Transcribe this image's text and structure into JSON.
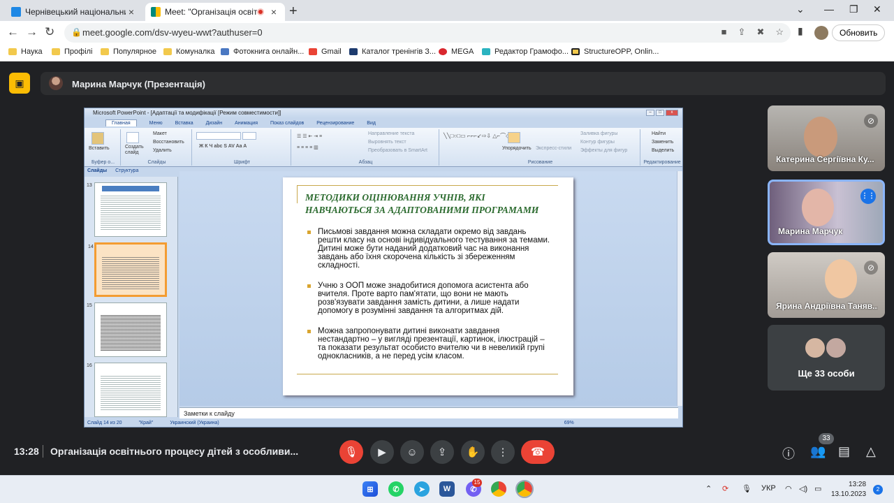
{
  "browser": {
    "tabs": [
      {
        "title": "Чернівецький національний у",
        "active": false,
        "favicon_color": "#1e88e5"
      },
      {
        "title": "Meet: \"Організація освітнь",
        "active": true,
        "favicon_color": "#00897b"
      }
    ],
    "url": "meet.google.com/dsv-wyeu-wwt?authuser=0",
    "renew_label": "Обновить",
    "bookmarks": [
      {
        "label": "Наука",
        "icon_color": "#f2c94c"
      },
      {
        "label": "Профілі",
        "icon_color": "#f2c94c"
      },
      {
        "label": "Популярное",
        "icon_color": "#f2c94c"
      },
      {
        "label": "Комуналка",
        "icon_color": "#f2c94c"
      },
      {
        "label": "Фотокнига онлайн...",
        "icon_color": "#4a78c2"
      },
      {
        "label": "Gmail",
        "icon_color": "#ea4335"
      },
      {
        "label": "Каталог тренінгів З...",
        "icon_color": "#1d3b6e"
      },
      {
        "label": "MEGA",
        "icon_color": "#d9272e"
      },
      {
        "label": "Редактор Грамофо...",
        "icon_color": "#2bb3c0"
      },
      {
        "label": "StructureOPP, Onlin...",
        "icon_color": "#222222"
      }
    ]
  },
  "meet": {
    "presenter_label": "Марина Марчук (Презентація)",
    "participants": [
      {
        "name": "Катерина Сергіївна Ку...",
        "muted": true,
        "speaking": false
      },
      {
        "name": "Марина Марчук",
        "muted": false,
        "speaking": true
      },
      {
        "name": "Ярина Андріївна Таняв...",
        "muted": true,
        "speaking": false
      }
    ],
    "more_label": "Ще 33 особи",
    "clock": "13:28",
    "meeting_name": "Організація освітнього процесу дітей з особливи...",
    "participants_count": "33"
  },
  "ppt": {
    "window_title": "Microsoft PowerPoint - [Адаптації та модифікації [Режим совместимости]]",
    "tabs": [
      "Главная",
      "Меню",
      "Вставка",
      "Дизайн",
      "Анимация",
      "Показ слайдов",
      "Рецензирование",
      "Вид"
    ],
    "ribbon": {
      "insert_btn": "Вставить",
      "create_slide": "Создать слайд",
      "layout": "Макет",
      "restore": "Восстановить",
      "delete": "Удалить",
      "clipboard": "Буфер о...",
      "slides": "Слайды",
      "font": "Шрифт",
      "paragraph": "Абзац",
      "text_dir": "Направление текста",
      "align_text": "Выровнять текст",
      "smartart": "Преобразовать в SmartArt",
      "arrange": "Упорядочить",
      "quick_styles": "Экспресс-стили",
      "fill": "Заливка фигуры",
      "outline": "Контур фигуры",
      "effects": "Эффекты для фигур",
      "drawing": "Рисование",
      "find": "Найти",
      "replace": "Заменить",
      "select": "Выделить",
      "editing": "Редактирование"
    },
    "pane_tabs": [
      "Слайды",
      "Структура"
    ],
    "thumb_numbers": [
      "13",
      "14",
      "15",
      "16"
    ],
    "slide_title": "МЕТОДИКИ ОЦІНЮВАННЯ УЧНІВ, ЯКІ НАВЧАЮТЬСЯ ЗА АДАПТОВАНИМИ ПРОГРАМАМИ",
    "bullets": [
      "Письмові завдання можна складати окремо від завдань решти класу на основі індивідуального тестування за темами. Дитині може бути наданий додатковий час на виконання завдань або їхня скорочена кількість зі збереженням складності.",
      "Учню з ООП може знадобитися допомога асистента або вчителя. Проте варто пам'ятати, що вони не мають розв'язувати завдання замість дитини, а лише надати допомогу в розумінні завдання та алгоритмах дій.",
      "Можна запропонувати дитині виконати завдання нестандартно – у вигляді презентації, картинок, ілюстрацій – та показати результат особисто вчителю чи в невеликій групі однокласників, а не перед усім класом."
    ],
    "notes_placeholder": "Заметки к слайду",
    "status": {
      "slide": "Слайд 14 из 20",
      "theme": "\"Край\"",
      "lang": "Украинский (Украина)",
      "zoom": "69%"
    }
  },
  "taskbar": {
    "lang": "УКР",
    "time": "13:28",
    "date": "13.10.2023",
    "notifications": "2",
    "viber_badge": "15"
  }
}
